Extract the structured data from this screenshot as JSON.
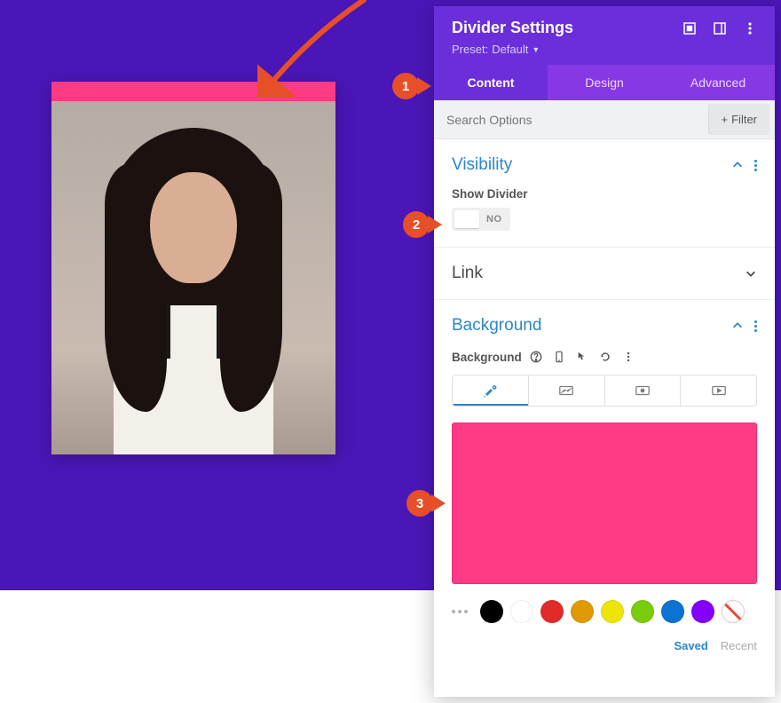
{
  "panel": {
    "title": "Divider Settings",
    "preset_label": "Preset:",
    "preset_value": "Default"
  },
  "tabs": {
    "content": "Content",
    "design": "Design",
    "advanced": "Advanced"
  },
  "search": {
    "placeholder": "Search Options",
    "filter_label": "Filter"
  },
  "visibility": {
    "title": "Visibility",
    "show_divider_label": "Show Divider",
    "toggle_state": "NO"
  },
  "link": {
    "title": "Link"
  },
  "background": {
    "title": "Background",
    "label": "Background",
    "selected_color": "#ff3a84",
    "palette": [
      "#000000",
      "#ffffff",
      "#e12b28",
      "#e09a06",
      "#ede50a",
      "#7acd0b",
      "#0c72d4",
      "#8400ff",
      "none"
    ],
    "saved_label": "Saved",
    "recent_label": "Recent"
  },
  "callouts": {
    "one": "1",
    "two": "2",
    "three": "3"
  }
}
